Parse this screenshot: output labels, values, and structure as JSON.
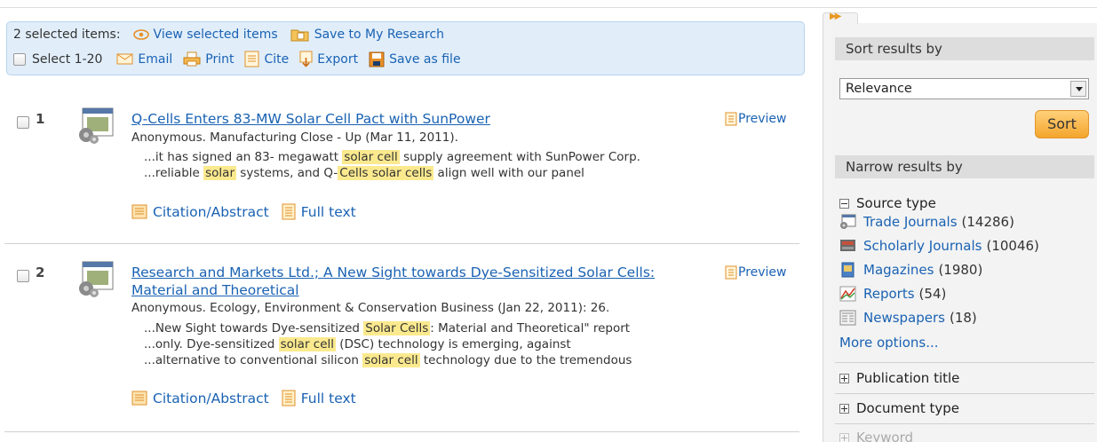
{
  "toolbar": {
    "selected_label": "2 selected items:",
    "view_selected": "View selected items",
    "save_research": "Save to My Research",
    "select_range": "Select 1-20",
    "email": "Email",
    "print": "Print",
    "cite": "Cite",
    "export": "Export",
    "save_file": "Save as file"
  },
  "results": [
    {
      "number": "1",
      "title": "Q-Cells Enters 83-MW Solar Cell Pact with SunPower",
      "meta": "Anonymous. Manufacturing Close - Up (Mar 11, 2011).",
      "preview": "Preview",
      "snippets": [
        {
          "pre": "...it has signed an 83- megawatt ",
          "hl": "solar cell",
          "post": " supply agreement with SunPower Corp."
        },
        {
          "pre": "...reliable ",
          "hl": "solar",
          "post": " systems, and Q-",
          "hl2": "Cells solar cells",
          "post2": " align well with our panel"
        }
      ],
      "citation": "Citation/Abstract",
      "fulltext": "Full text"
    },
    {
      "number": "2",
      "title_line1": "Research and Markets Ltd.; A New Sight towards Dye-Sensitized Solar Cells:",
      "title_line2": "Material and Theoretical",
      "meta": "Anonymous. Ecology, Environment & Conservation Business (Jan 22, 2011): 26.",
      "preview": "Preview",
      "snippets": [
        {
          "pre": "...New Sight towards Dye-sensitized ",
          "hl": "Solar Cells",
          "post": ": Material and Theoretical\" report"
        },
        {
          "pre": "...only. Dye-sensitized ",
          "hl": "solar cell",
          "post": " (DSC) technology is emerging, against"
        },
        {
          "pre": "...alternative to conventional silicon ",
          "hl": "solar cell",
          "post": " technology due to the tremendous"
        }
      ],
      "citation": "Citation/Abstract",
      "fulltext": "Full text"
    }
  ],
  "sidebar": {
    "tab_glyph": "▶▶",
    "sort_header": "Sort results by",
    "sort_value": "Relevance",
    "sort_button": "Sort",
    "narrow_header": "Narrow results by",
    "source_type_title": "Source type",
    "source_types": [
      {
        "label": "Trade Journals",
        "count": "(14286)",
        "icon": "trade-journal-icon"
      },
      {
        "label": "Scholarly Journals",
        "count": "(10046)",
        "icon": "scholarly-journal-icon"
      },
      {
        "label": "Magazines",
        "count": "(1980)",
        "icon": "magazine-icon"
      },
      {
        "label": "Reports",
        "count": "(54)",
        "icon": "report-icon"
      },
      {
        "label": "Newspapers",
        "count": "(18)",
        "icon": "newspaper-icon"
      }
    ],
    "more_options": "More options...",
    "publication_title": "Publication title",
    "document_type": "Document type",
    "keyword": "Keyword"
  },
  "colors": {
    "link": "#1a62b3",
    "highlight": "#fbe98e",
    "toolbar_bg": "#e1eefa",
    "sort_button": "#f3a52c"
  }
}
